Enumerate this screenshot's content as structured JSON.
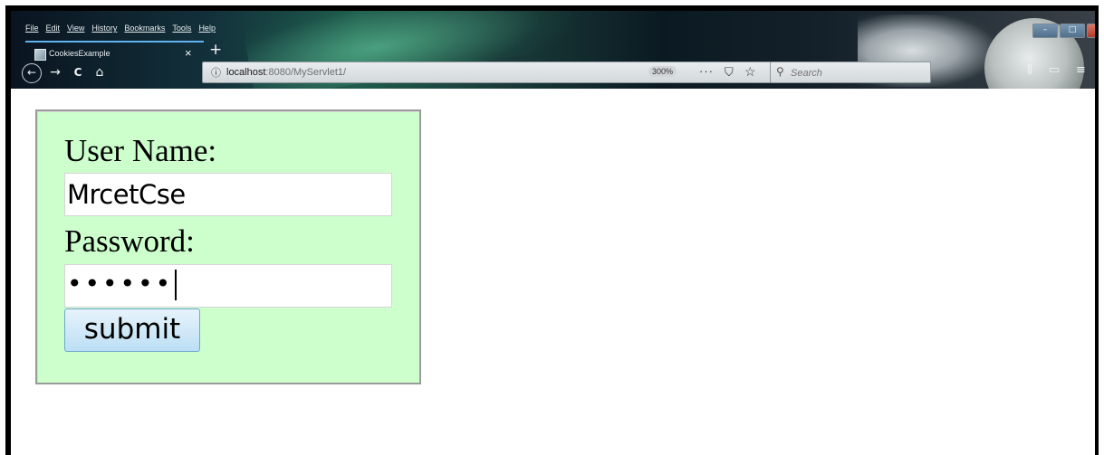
{
  "menubar": [
    "File",
    "Edit",
    "View",
    "History",
    "Bookmarks",
    "Tools",
    "Help"
  ],
  "tab": {
    "title": "CookiesExample",
    "close": "×",
    "new_tab": "+"
  },
  "nav": {
    "back": "←",
    "forward": "→",
    "reload": "C",
    "home": "⌂"
  },
  "urlbar": {
    "host": "localhost",
    "path": ":8080/MyServlet1/",
    "zoom": "300%",
    "page_actions": "···"
  },
  "search": {
    "placeholder": "Search"
  },
  "window_buttons": {
    "minimize": "–",
    "maximize": "□",
    "close": "x"
  },
  "form": {
    "username_label": "User Name:",
    "username_value": "MrcetCse",
    "password_label": "Password:",
    "password_mask": "••••••",
    "submit_label": "submit"
  },
  "colors": {
    "form_background": "#ccffcc",
    "submit_background": "#bcdff4",
    "page_background": "#ffffff"
  },
  "icons": {
    "info": "info-icon",
    "pocket": "pocket-icon",
    "bookmark": "star-icon",
    "search": "search-icon",
    "menu": "hamburger-menu-icon"
  }
}
